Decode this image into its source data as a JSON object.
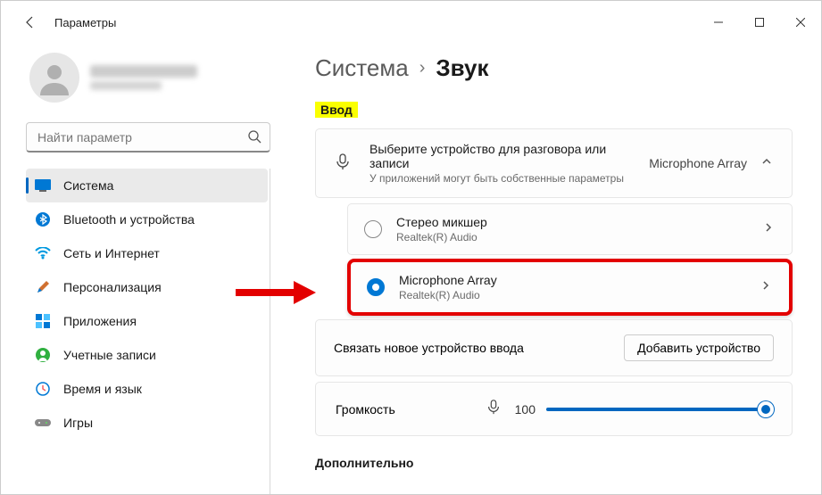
{
  "titlebar": {
    "title": "Параметры"
  },
  "search": {
    "placeholder": "Найти параметр"
  },
  "nav": {
    "items": [
      {
        "label": "Система"
      },
      {
        "label": "Bluetooth и устройства"
      },
      {
        "label": "Сеть и Интернет"
      },
      {
        "label": "Персонализация"
      },
      {
        "label": "Приложения"
      },
      {
        "label": "Учетные записи"
      },
      {
        "label": "Время и язык"
      },
      {
        "label": "Игры"
      }
    ]
  },
  "breadcrumb": {
    "parent": "Система",
    "current": "Звук"
  },
  "section": {
    "input_header": "Ввод"
  },
  "inputdev": {
    "title": "Выберите устройство для разговора или записи",
    "subtitle": "У приложений могут быть собственные параметры",
    "current": "Microphone Array"
  },
  "devices": [
    {
      "name": "Стерео микшер",
      "driver": "Realtek(R) Audio",
      "selected": false
    },
    {
      "name": "Microphone Array",
      "driver": "Realtek(R) Audio",
      "selected": true
    }
  ],
  "pair": {
    "label": "Связать новое устройство ввода",
    "button": "Добавить устройство"
  },
  "volume": {
    "label": "Громкость",
    "value": "100"
  },
  "more": {
    "header": "Дополнительно"
  }
}
